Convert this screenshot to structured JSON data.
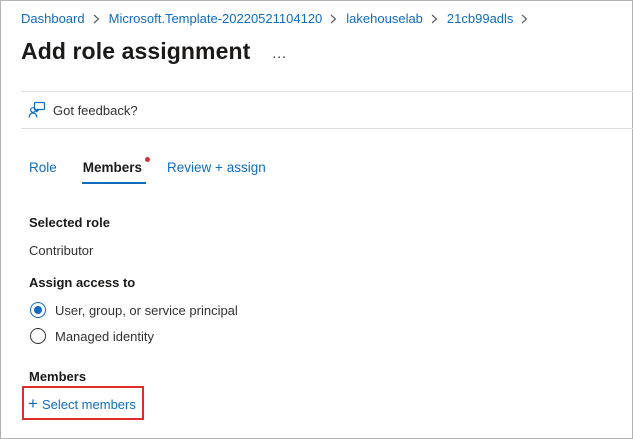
{
  "breadcrumb": {
    "items": [
      "Dashboard",
      "Microsoft.Template-20220521104120",
      "lakehouselab",
      "21cb99adls"
    ]
  },
  "header": {
    "title": "Add role assignment",
    "more": "..."
  },
  "toolbar": {
    "feedback_label": "Got feedback?"
  },
  "tabs": [
    {
      "label": "Role"
    },
    {
      "label": "Members"
    },
    {
      "label": "Review + assign"
    }
  ],
  "selected_role": {
    "label": "Selected role",
    "value": "Contributor"
  },
  "assign_access": {
    "label": "Assign access to",
    "options": [
      {
        "label": "User, group, or service principal",
        "checked": true
      },
      {
        "label": "Managed identity",
        "checked": false
      }
    ]
  },
  "members": {
    "label": "Members",
    "select_label": "Select members"
  },
  "colors": {
    "link": "#0f6cbd",
    "highlight_box": "#e12c2c",
    "required_dot": "#d13438"
  }
}
